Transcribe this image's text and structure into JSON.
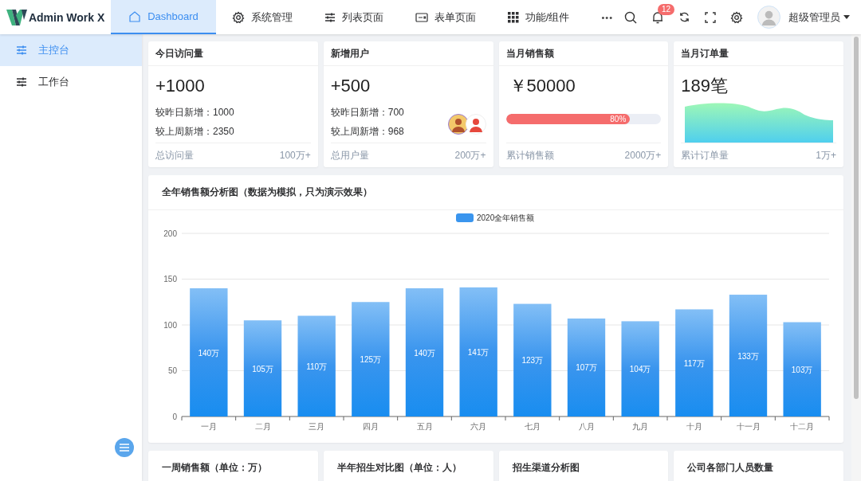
{
  "header": {
    "logo": "Admin Work X",
    "tabs": [
      {
        "label": "Dashboard",
        "selected": true
      },
      {
        "label": "系统管理",
        "selected": false
      },
      {
        "label": "列表页面",
        "selected": false
      },
      {
        "label": "表单页面",
        "selected": false
      },
      {
        "label": "功能/组件",
        "selected": false
      }
    ],
    "more": "•••",
    "notification_count": "12",
    "user": "超级管理员"
  },
  "sidebar": {
    "items": [
      {
        "label": "主控台",
        "selected": true
      },
      {
        "label": "工作台",
        "selected": false
      }
    ]
  },
  "stat_cards": [
    {
      "kind": "plain",
      "title": "今日访问量",
      "value": "+1000",
      "lines": [
        "较昨日新增：1000",
        "较上周新增：2350"
      ],
      "footer_label": "总访问量",
      "footer_value": "100万+"
    },
    {
      "kind": "avatars",
      "title": "新增用户",
      "value": "+500",
      "lines": [
        "较昨日新增：700",
        "较上周新增：968"
      ],
      "footer_label": "总用户量",
      "footer_value": "200万+"
    },
    {
      "kind": "progress",
      "title": "当月销售额",
      "value": "￥50000",
      "level": 0.8,
      "reading": "80%",
      "footer_label": "累计销售额",
      "footer_value": "2000万+"
    },
    {
      "kind": "sparkline",
      "title": "当月订单量",
      "value": "189笔",
      "footer_label": "累计订单量",
      "footer_value": "1万+"
    }
  ],
  "sales_chart": {
    "title": "全年销售额分析图（数据为模拟，只为演示效果）",
    "chart_data": {
      "type": "bar",
      "categories": [
        "一月",
        "二月",
        "三月",
        "四月",
        "五月",
        "六月",
        "七月",
        "八月",
        "九月",
        "十月",
        "十一月",
        "十二月"
      ],
      "series": [
        {
          "name": "2020全年销售额",
          "color": "#3a95ee",
          "values": [
            140,
            105,
            110,
            125,
            140,
            141,
            123,
            107,
            104,
            117,
            133,
            103
          ]
        }
      ],
      "grid": true,
      "ylim": [
        0,
        200
      ],
      "yticks": [
        0,
        50,
        100,
        150,
        200
      ],
      "value_labels": [
        "140万",
        "105万",
        "110万",
        "125万",
        "140万",
        "141万",
        "123万",
        "107万",
        "104万",
        "117万",
        "133万",
        "103万"
      ]
    }
  },
  "bottom_cards": [
    {
      "title": "一周销售额（单位：万）"
    },
    {
      "title": "半年招生对比图（单位：人）"
    },
    {
      "title": "招生渠道分析图"
    },
    {
      "title": "公司各部门人员数量"
    }
  ]
}
